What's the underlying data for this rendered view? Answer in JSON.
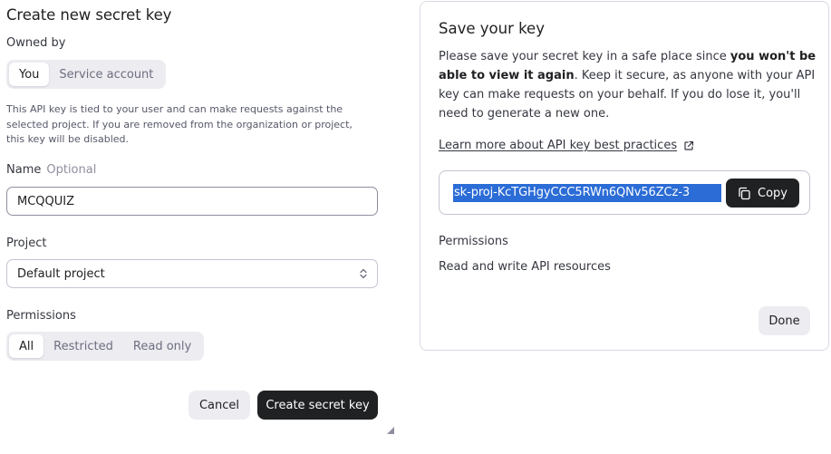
{
  "create_form": {
    "title": "Create new secret key",
    "owned_by": {
      "label": "Owned by",
      "options": [
        "You",
        "Service account"
      ],
      "selected": "You"
    },
    "description": "This API key is tied to your user and can make requests against the selected project. If you are removed from the organization or project, this key will be disabled.",
    "name": {
      "label": "Name",
      "optional_tag": "Optional",
      "value": "MCQQUIZ"
    },
    "project": {
      "label": "Project",
      "value": "Default project",
      "icon": "chevron-up-down-icon"
    },
    "permissions": {
      "label": "Permissions",
      "options": [
        "All",
        "Restricted",
        "Read only"
      ],
      "selected": "All"
    },
    "cancel_label": "Cancel",
    "create_label": "Create secret key"
  },
  "save_modal": {
    "title": "Save your key",
    "text_part1": "Please save your secret key in a safe place since ",
    "text_bold": "you won't be able to view it again",
    "text_part2": ". Keep it secure, as anyone with your API key can make requests on your behalf. If you do lose it, you'll need to generate a new one.",
    "link_label": "Learn more about API key best practices",
    "link_icon": "external-link-icon",
    "key_value": "sk-proj-KcTGHgyCCC5RWn6QNv56ZCz-3",
    "copy_label": "Copy",
    "copy_icon": "copy-icon",
    "permissions_label": "Permissions",
    "permissions_value": "Read and write API resources",
    "done_label": "Done"
  },
  "colors": {
    "dark_button": "#202123",
    "light_button": "#ececf1",
    "selection_highlight": "#2b6cd6"
  }
}
